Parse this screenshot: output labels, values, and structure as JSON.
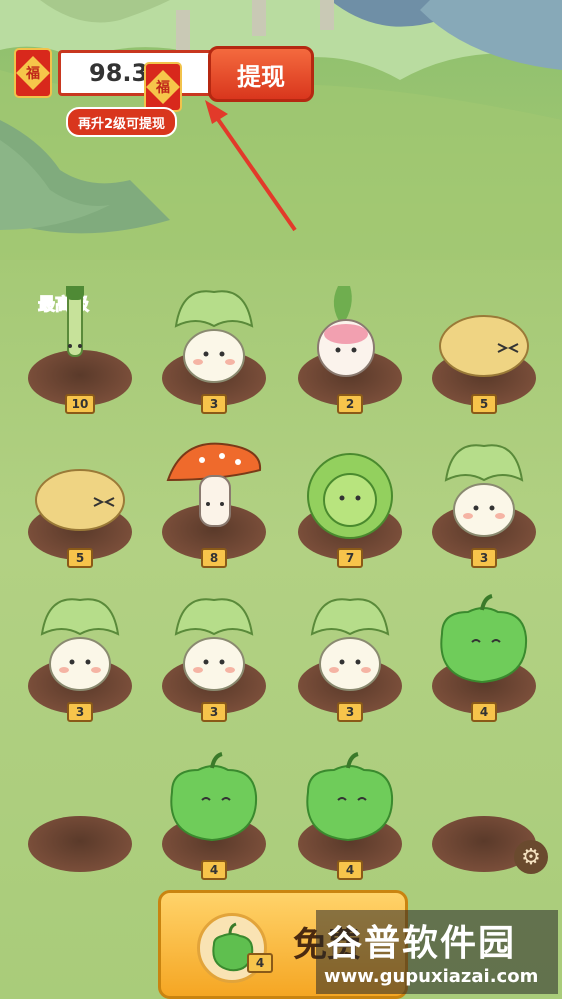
{
  "top": {
    "balance": "98.31",
    "withdraw_label": "提现",
    "level_tip": "再升2级可提现",
    "fu_char": "福"
  },
  "max_level_label": "最高级",
  "plots": [
    {
      "level": "10",
      "crop": "leek"
    },
    {
      "level": "3",
      "crop": "bok-choy"
    },
    {
      "level": "2",
      "crop": "radish"
    },
    {
      "level": "5",
      "crop": "potato"
    },
    {
      "level": "5",
      "crop": "potato"
    },
    {
      "level": "8",
      "crop": "mushroom"
    },
    {
      "level": "7",
      "crop": "cabbage"
    },
    {
      "level": "3",
      "crop": "bok-choy"
    },
    {
      "level": "3",
      "crop": "bok-choy"
    },
    {
      "level": "3",
      "crop": "bok-choy"
    },
    {
      "level": "3",
      "crop": "bok-choy"
    },
    {
      "level": "4",
      "crop": "pepper"
    },
    {
      "level": "",
      "crop": "empty"
    },
    {
      "level": "4",
      "crop": "pepper"
    },
    {
      "level": "4",
      "crop": "pepper"
    },
    {
      "level": "",
      "crop": "empty"
    }
  ],
  "buy": {
    "label": "免费",
    "level": "4"
  },
  "watermark": {
    "title": "谷普软件园",
    "url": "www.gupuxiazai.com"
  }
}
